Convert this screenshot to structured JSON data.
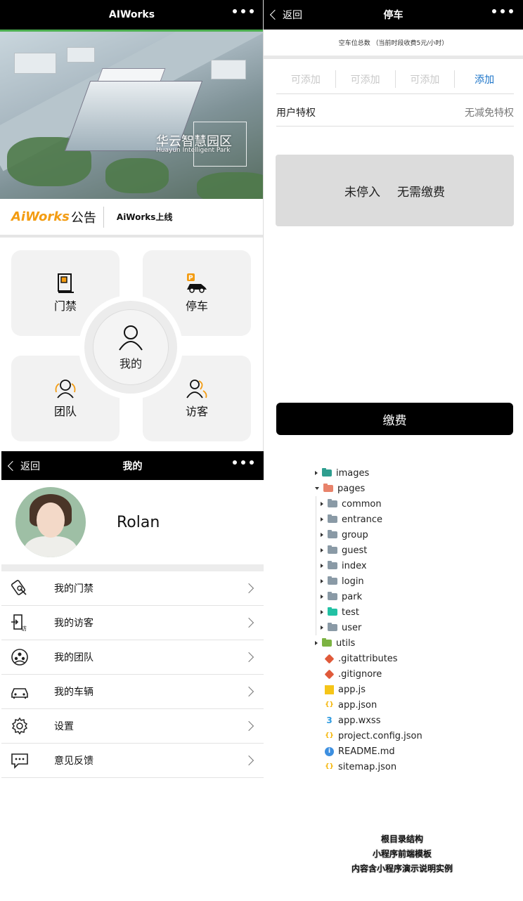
{
  "home": {
    "title": "AIWorks",
    "banner_title": "华云智慧园区",
    "banner_subtitle": "Huayun Intelligent Park",
    "notice_brand": "AiWorks",
    "notice_label": "公告",
    "notice_text": "AiWorks上线",
    "tiles": {
      "entrance": "门禁",
      "parking": "停车",
      "team": "团队",
      "visitor": "访客",
      "mine": "我的"
    }
  },
  "parking": {
    "back": "返回",
    "title": "停车",
    "info": "空车位总数 （当前时段收费5元/小时）",
    "slots": [
      "可添加",
      "可添加",
      "可添加",
      "添加"
    ],
    "privilege_label": "用户特权",
    "privilege_value": "无减免特权",
    "status_parked": "未停入",
    "status_fee": "无需缴费",
    "pay_button": "缴费"
  },
  "mine": {
    "back": "返回",
    "title": "我的",
    "username": "Rolan",
    "menu": [
      {
        "label": "我的门禁",
        "icon": "access-card-icon"
      },
      {
        "label": "我的访客",
        "icon": "visitor-door-icon"
      },
      {
        "label": "我的团队",
        "icon": "team-icon"
      },
      {
        "label": "我的车辆",
        "icon": "car-icon"
      },
      {
        "label": "设置",
        "icon": "gear-icon"
      },
      {
        "label": "意见反馈",
        "icon": "chat-icon"
      }
    ]
  },
  "tree": {
    "items": [
      {
        "name": "images",
        "color": "#2e9e8f"
      },
      {
        "name": "pages",
        "color": "#e8836b"
      },
      {
        "name": "common",
        "color": "#8a9aa6"
      },
      {
        "name": "entrance",
        "color": "#8a9aa6"
      },
      {
        "name": "group",
        "color": "#8a9aa6"
      },
      {
        "name": "guest",
        "color": "#8a9aa6"
      },
      {
        "name": "index",
        "color": "#8a9aa6"
      },
      {
        "name": "login",
        "color": "#8a9aa6"
      },
      {
        "name": "park",
        "color": "#8a9aa6"
      },
      {
        "name": "test",
        "color": "#22c1a4"
      },
      {
        "name": "user",
        "color": "#8a9aa6"
      },
      {
        "name": "utils",
        "color": "#7cb342"
      },
      {
        "name": ".gitattributes",
        "color": "#e05a3a"
      },
      {
        "name": ".gitignore",
        "color": "#e05a3a"
      },
      {
        "name": "app.js",
        "color": "#f5c518"
      },
      {
        "name": "app.json",
        "color": "#f5b400"
      },
      {
        "name": "app.wxss",
        "color": "#2f9be0"
      },
      {
        "name": "project.config.json",
        "color": "#f5b400"
      },
      {
        "name": "README.md",
        "color": "#3d8fe0"
      },
      {
        "name": "sitemap.json",
        "color": "#f5b400"
      }
    ]
  },
  "caption": [
    "根目录结构",
    "小程序前端模板",
    "内容含小程序演示说明实例"
  ]
}
